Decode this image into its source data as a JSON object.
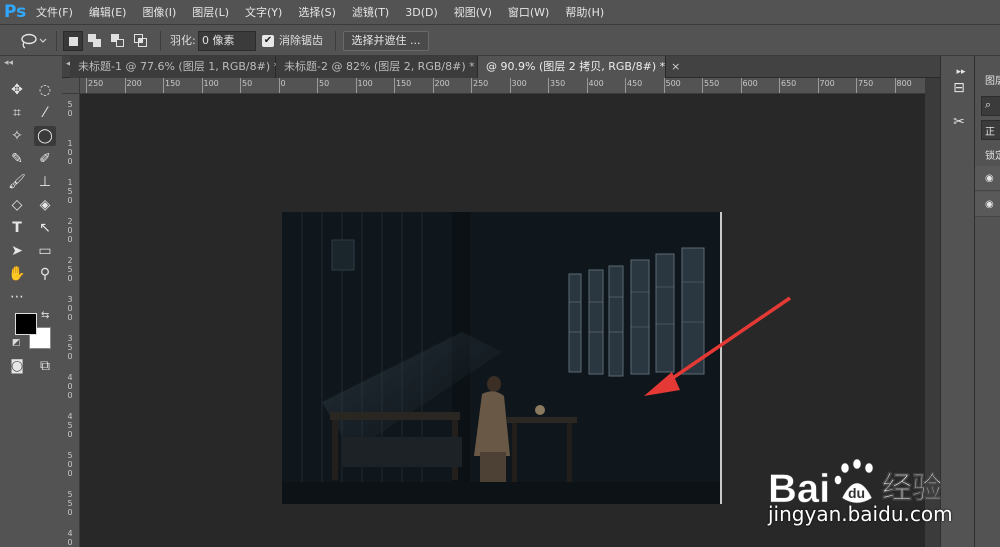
{
  "app": {
    "logo": "Ps",
    "accent": "#31a8ff"
  },
  "menu": [
    "文件(F)",
    "编辑(E)",
    "图像(I)",
    "图层(L)",
    "文字(Y)",
    "选择(S)",
    "滤镜(T)",
    "3D(D)",
    "视图(V)",
    "窗口(W)",
    "帮助(H)"
  ],
  "options": {
    "tool_icon": "lasso-icon",
    "feather_label": "羽化:",
    "feather_value": "0 像素",
    "antialias_label": "消除锯齿",
    "antialias_checked": true,
    "select_mask_label": "选择并遮住 ..."
  },
  "tabs": [
    {
      "label": "未标题-1 @ 77.6% (图层 1, RGB/8#) *",
      "close": "×",
      "active": false
    },
    {
      "label": "未标题-2 @ 82% (图层 2, RGB/8#) *",
      "close": "×",
      "active": false
    },
    {
      "label": "@ 90.9% (图层 2 拷贝, RGB/8#) *",
      "close": "×",
      "active": true
    }
  ],
  "ruler_top": [
    "250",
    "200",
    "150",
    "100",
    "50",
    "0",
    "50",
    "100",
    "150",
    "200",
    "250",
    "300",
    "350",
    "400",
    "450",
    "500",
    "550",
    "600",
    "650",
    "700",
    "750",
    "800",
    "850",
    "900"
  ],
  "ruler_left": [
    "5\n0",
    "1\n0\n0",
    "1\n5\n0",
    "2\n0\n0",
    "2\n5\n0",
    "3\n0\n0",
    "3\n5\n0",
    "4\n0\n0",
    "4\n5\n0",
    "5\n0\n0",
    "5\n5\n0",
    "4\n0"
  ],
  "colors": {
    "foreground": "#000000",
    "background": "#ffffff",
    "arrow": "#e53935"
  },
  "right_panel": {
    "top_label": "图层",
    "search_icon": "search-icon",
    "blend_label": "正",
    "lock_label": "锁定"
  },
  "watermark": {
    "brand": "Bai",
    "brand_suffix": "经验",
    "url": "jingyan.baidu.com"
  }
}
